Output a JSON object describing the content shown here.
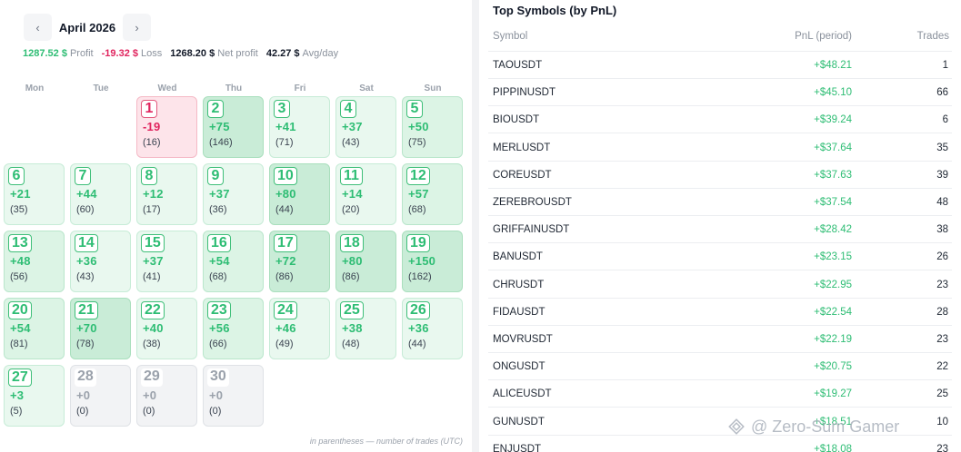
{
  "calendar": {
    "prev_label": "‹",
    "next_label": "›",
    "month": "April 2026",
    "stats": {
      "profit_value": "1287.52 $",
      "profit_label": "Profit",
      "loss_value": "-19.32 $",
      "loss_label": "Loss",
      "net_value": "1268.20 $",
      "net_label": "Net profit",
      "avg_value": "42.27 $",
      "avg_label": "Avg/day"
    },
    "weekdays": [
      "Mon",
      "Tue",
      "Wed",
      "Thu",
      "Fri",
      "Sat",
      "Sun"
    ],
    "days": [
      {
        "day": "1",
        "pnl": "-19",
        "trades": "(16)",
        "tone": "neg"
      },
      {
        "day": "2",
        "pnl": "+75",
        "trades": "(146)",
        "tone": "g3"
      },
      {
        "day": "3",
        "pnl": "+41",
        "trades": "(71)",
        "tone": "g1"
      },
      {
        "day": "4",
        "pnl": "+37",
        "trades": "(43)",
        "tone": "g1"
      },
      {
        "day": "5",
        "pnl": "+50",
        "trades": "(75)",
        "tone": "g2"
      },
      {
        "day": "6",
        "pnl": "+21",
        "trades": "(35)",
        "tone": "g1"
      },
      {
        "day": "7",
        "pnl": "+44",
        "trades": "(60)",
        "tone": "g1"
      },
      {
        "day": "8",
        "pnl": "+12",
        "trades": "(17)",
        "tone": "g1"
      },
      {
        "day": "9",
        "pnl": "+37",
        "trades": "(36)",
        "tone": "g1"
      },
      {
        "day": "10",
        "pnl": "+80",
        "trades": "(44)",
        "tone": "g3"
      },
      {
        "day": "11",
        "pnl": "+14",
        "trades": "(20)",
        "tone": "g1"
      },
      {
        "day": "12",
        "pnl": "+57",
        "trades": "(68)",
        "tone": "g2"
      },
      {
        "day": "13",
        "pnl": "+48",
        "trades": "(56)",
        "tone": "g2"
      },
      {
        "day": "14",
        "pnl": "+36",
        "trades": "(43)",
        "tone": "g1"
      },
      {
        "day": "15",
        "pnl": "+37",
        "trades": "(41)",
        "tone": "g1"
      },
      {
        "day": "16",
        "pnl": "+54",
        "trades": "(68)",
        "tone": "g2"
      },
      {
        "day": "17",
        "pnl": "+72",
        "trades": "(86)",
        "tone": "g3"
      },
      {
        "day": "18",
        "pnl": "+80",
        "trades": "(86)",
        "tone": "g3"
      },
      {
        "day": "19",
        "pnl": "+150",
        "trades": "(162)",
        "tone": "g3"
      },
      {
        "day": "20",
        "pnl": "+54",
        "trades": "(81)",
        "tone": "g2"
      },
      {
        "day": "21",
        "pnl": "+70",
        "trades": "(78)",
        "tone": "g3"
      },
      {
        "day": "22",
        "pnl": "+40",
        "trades": "(38)",
        "tone": "g1"
      },
      {
        "day": "23",
        "pnl": "+56",
        "trades": "(66)",
        "tone": "g2"
      },
      {
        "day": "24",
        "pnl": "+46",
        "trades": "(49)",
        "tone": "g1"
      },
      {
        "day": "25",
        "pnl": "+38",
        "trades": "(48)",
        "tone": "g1"
      },
      {
        "day": "26",
        "pnl": "+36",
        "trades": "(44)",
        "tone": "g1"
      },
      {
        "day": "27",
        "pnl": "+3",
        "trades": "(5)",
        "tone": "g1"
      },
      {
        "day": "28",
        "pnl": "+0",
        "trades": "(0)",
        "tone": "fut"
      },
      {
        "day": "29",
        "pnl": "+0",
        "trades": "(0)",
        "tone": "fut"
      },
      {
        "day": "30",
        "pnl": "+0",
        "trades": "(0)",
        "tone": "fut"
      }
    ],
    "footnote": "in parentheses — number of trades (UTC)"
  },
  "top_symbols": {
    "title": "Top Symbols (by PnL)",
    "columns": {
      "symbol": "Symbol",
      "pnl": "PnL (period)",
      "trades": "Trades"
    },
    "rows": [
      {
        "symbol": "TAOUSDT",
        "pnl": "+$48.21",
        "trades": "1"
      },
      {
        "symbol": "PIPPINUSDT",
        "pnl": "+$45.10",
        "trades": "66"
      },
      {
        "symbol": "BIOUSDT",
        "pnl": "+$39.24",
        "trades": "6"
      },
      {
        "symbol": "MERLUSDT",
        "pnl": "+$37.64",
        "trades": "35"
      },
      {
        "symbol": "COREUSDT",
        "pnl": "+$37.63",
        "trades": "39"
      },
      {
        "symbol": "ZEREBROUSDT",
        "pnl": "+$37.54",
        "trades": "48"
      },
      {
        "symbol": "GRIFFAINUSDT",
        "pnl": "+$28.42",
        "trades": "38"
      },
      {
        "symbol": "BANUSDT",
        "pnl": "+$23.15",
        "trades": "26"
      },
      {
        "symbol": "CHRUSDT",
        "pnl": "+$22.95",
        "trades": "23"
      },
      {
        "symbol": "FIDAUSDT",
        "pnl": "+$22.54",
        "trades": "28"
      },
      {
        "symbol": "MOVRUSDT",
        "pnl": "+$22.19",
        "trades": "23"
      },
      {
        "symbol": "ONGUSDT",
        "pnl": "+$20.75",
        "trades": "22"
      },
      {
        "symbol": "ALICEUSDT",
        "pnl": "+$19.27",
        "trades": "25"
      },
      {
        "symbol": "GUNUSDT",
        "pnl": "+$18.51",
        "trades": "10"
      },
      {
        "symbol": "ENJUSDT",
        "pnl": "+$18.08",
        "trades": "23"
      }
    ]
  },
  "watermark": {
    "text": "@ Zero-Sum Gamer",
    "icon": "zero-sum-logo-icon"
  },
  "colors": {
    "profit": "#2ebd74",
    "loss": "#e0245e",
    "muted": "#9aa1ab"
  }
}
